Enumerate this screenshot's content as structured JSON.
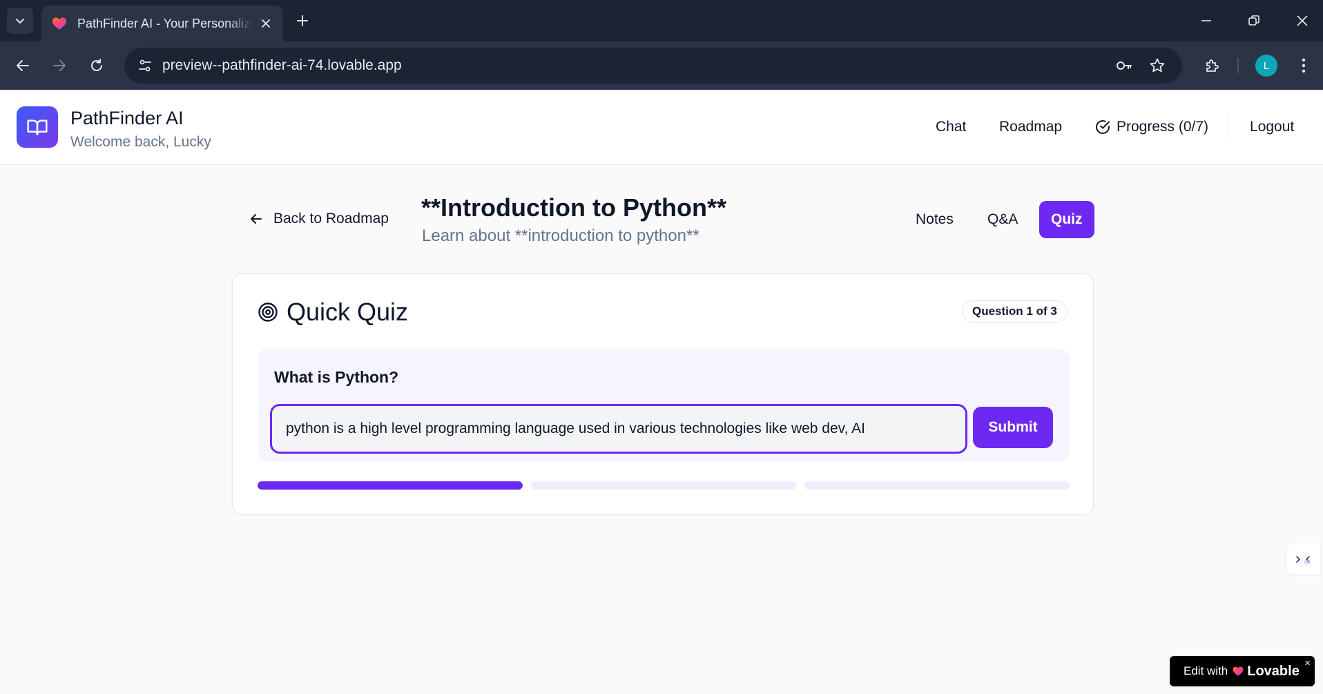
{
  "browser": {
    "tab_title": "PathFinder AI - Your Personalized",
    "url": "preview--pathfinder-ai-74.lovable.app",
    "profile_initial": "L"
  },
  "header": {
    "app_name": "PathFinder AI",
    "welcome": "Welcome back, Lucky",
    "nav": {
      "chat": "Chat",
      "roadmap": "Roadmap",
      "progress": "Progress (0/7)",
      "logout": "Logout"
    }
  },
  "topic": {
    "back_label": "Back to Roadmap",
    "title": "**Introduction to Python**",
    "subtitle": "Learn about **introduction to python**",
    "tabs": {
      "notes": "Notes",
      "qa": "Q&A",
      "quiz": "Quiz"
    }
  },
  "quiz": {
    "title": "Quick Quiz",
    "badge": "Question 1 of 3",
    "question": "What is Python?",
    "answer_value": "python is a high level programming language used in various technologies like web dev, AI",
    "submit_label": "Submit",
    "progress_steps": [
      1,
      0,
      0
    ]
  },
  "lovable": {
    "prefix": "Edit with",
    "brand": "Lovable",
    "close": "×"
  },
  "colors": {
    "accent": "#6d28f2",
    "browser_dark": "#1c2434",
    "browser_toolbar": "#2b3446"
  }
}
